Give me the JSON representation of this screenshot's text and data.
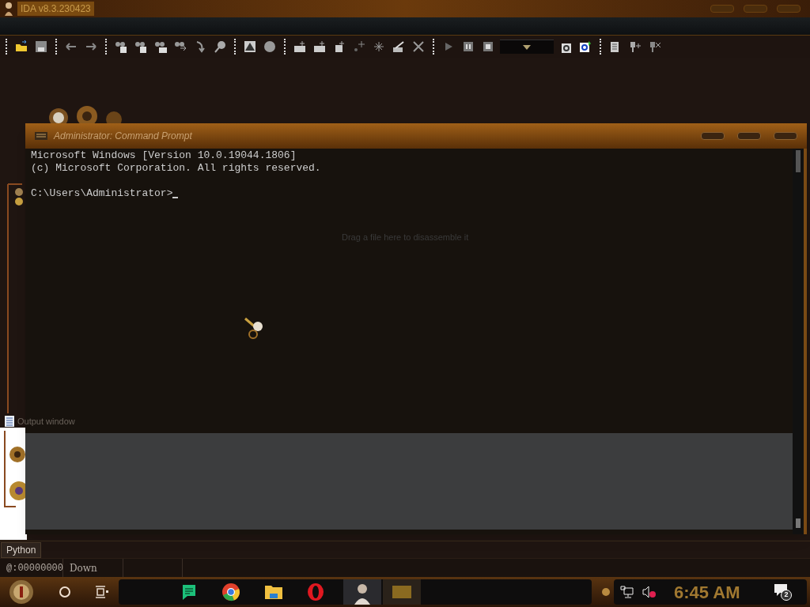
{
  "window": {
    "title": "IDA v8.3.230423"
  },
  "background_hint": "Drag a file here to disassemble it",
  "console": {
    "title": "Administrator: Command Prompt",
    "output": [
      "Microsoft Windows [Version 10.0.19044.1806]",
      "(c) Microsoft Corporation. All rights reserved."
    ],
    "prompt": "C:\\Users\\Administrator>"
  },
  "output_window": {
    "title": "Output window"
  },
  "tabs": [
    {
      "label": "Python",
      "selected": true
    }
  ],
  "status_bar": [
    "@:00000000",
    "Down"
  ],
  "taskbar": {
    "clock": "6:45 AM",
    "notifications": "2"
  }
}
